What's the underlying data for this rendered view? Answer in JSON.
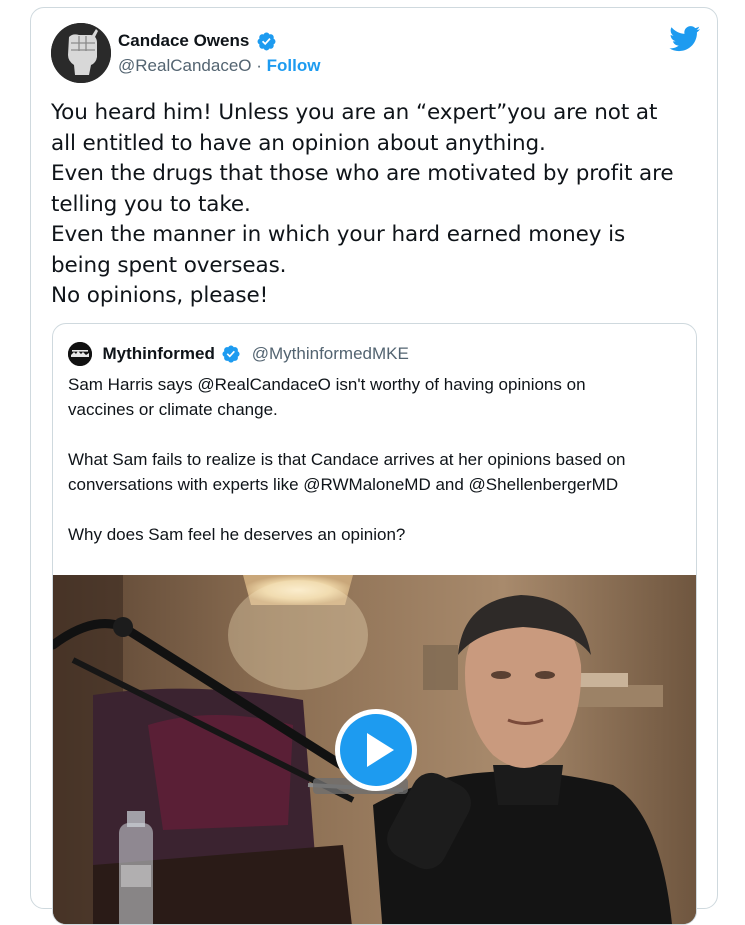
{
  "author": {
    "name": "Candace Owens",
    "handle": "@RealCandaceO",
    "separator": " · ",
    "follow_label": "Follow",
    "verified": true
  },
  "tweet": {
    "lines": [
      "You heard him! Unless you are an “expert”you are not at",
      "all entitled to have an opinion about anything.",
      "Even the drugs that those who are motivated by profit are",
      "telling you to take.",
      "Even the manner in which your hard earned money is",
      "being spent overseas.",
      "No opinions, please!"
    ]
  },
  "quoted": {
    "name": "Mythinformed",
    "handle": "@MythinformedMKE",
    "verified": true,
    "lines": [
      "Sam Harris says @RealCandaceO isn't worthy of having opinions on",
      "vaccines or climate change.",
      "",
      "What Sam fails to realize is that Candace arrives at her opinions based on",
      "conversations with experts like @RWMaloneMD and @ShellenbergerMD",
      "",
      "Why does Sam feel he deserves an opinion?"
    ],
    "media": {
      "type": "video",
      "play_icon": "play-icon"
    }
  },
  "icons": {
    "brand": "twitter-bird-icon",
    "verified": "verified-badge-icon"
  },
  "colors": {
    "accent": "#1d9bf0",
    "text": "#0f1419",
    "secondary": "#536471",
    "border": "#cfd9de"
  }
}
